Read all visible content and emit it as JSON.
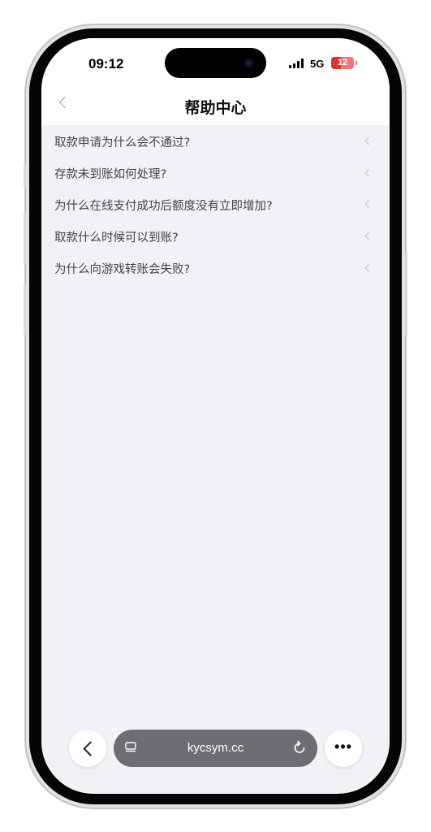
{
  "status_bar": {
    "time": "09:12",
    "network": "5G",
    "battery": "12"
  },
  "header": {
    "back_icon": "chevron-left-icon",
    "title": "帮助中心"
  },
  "faq": {
    "items": [
      {
        "label": "取款申请为什么会不通过?"
      },
      {
        "label": "存款未到账如何处理?"
      },
      {
        "label": "为什么在线支付成功后额度没有立即增加?"
      },
      {
        "label": "取款什么时候可以到账?"
      },
      {
        "label": "为什么向游戏转账会失败?"
      }
    ]
  },
  "browser": {
    "url": "kycsym.cc",
    "more_label": "•••"
  },
  "colors": {
    "page_background": "#f2f1f6",
    "header_background": "#ffffff",
    "battery_low": "#e2332f",
    "address_bar": "#6e6e72"
  }
}
